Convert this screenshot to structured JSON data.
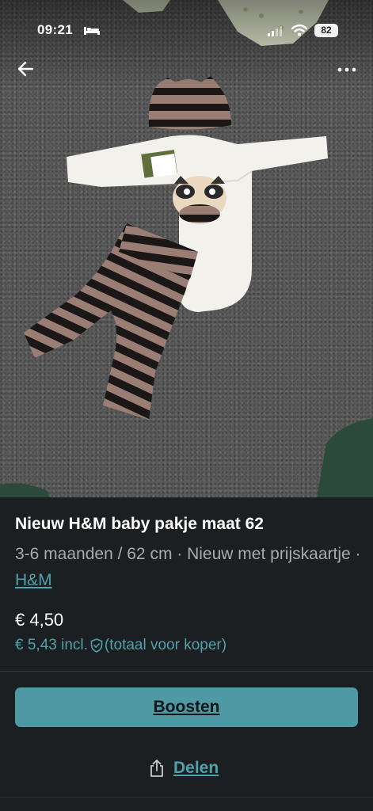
{
  "status_bar": {
    "time": "09:21",
    "battery": "82",
    "icons": [
      "bed-icon",
      "signal-icon",
      "wifi-icon",
      "battery-icon"
    ]
  },
  "top_nav": {
    "back_icon": "back-arrow-icon",
    "more_icon": "more-options-icon"
  },
  "listing": {
    "title": "Nieuw H&M baby pakje maat 62",
    "details_text": "3-6 maanden / 62 cm · Nieuw met prijskaartje · ",
    "brand": "H&M",
    "price": "€ 4,50",
    "price_incl": "€ 5,43 incl.",
    "price_incl_note": "(totaal voor koper)"
  },
  "actions": {
    "boost_label": "Boosten",
    "share_label": "Delen"
  },
  "colors": {
    "accent": "#4e99a3",
    "link": "#4fa2ad",
    "background": "#1b1f21",
    "muted_text": "#a6abad"
  }
}
